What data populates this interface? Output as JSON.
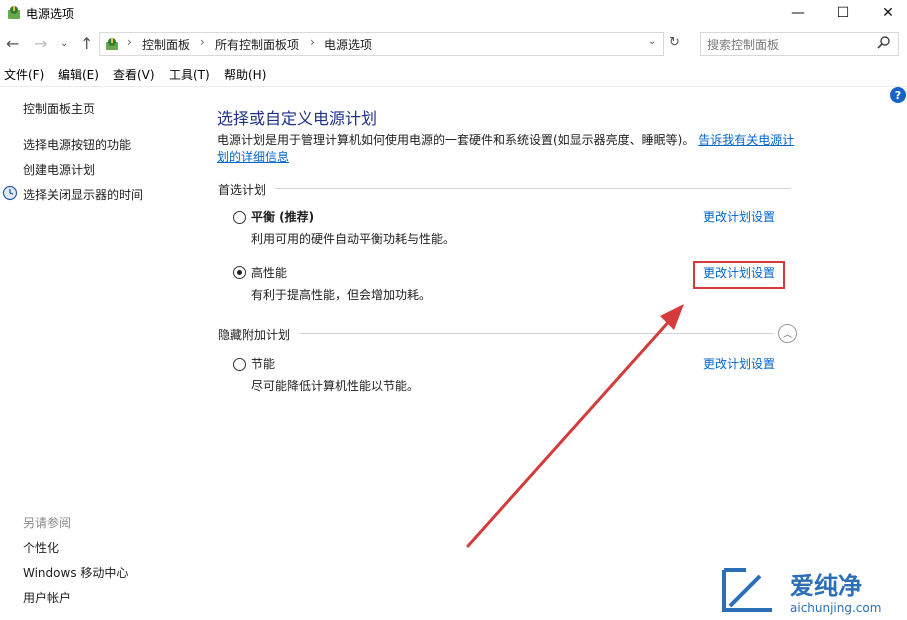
{
  "window": {
    "title": "电源选项",
    "controls": {
      "minimize": "—",
      "maximize": "☐",
      "close": "✕"
    }
  },
  "addressbar": {
    "breadcrumbs": [
      "控制面板",
      "所有控制面板项",
      "电源选项"
    ],
    "search_placeholder": "搜索控制面板"
  },
  "menu": [
    "文件(F)",
    "编辑(E)",
    "查看(V)",
    "工具(T)",
    "帮助(H)"
  ],
  "left_pane": {
    "home": "控制面板主页",
    "links": [
      "选择电源按钮的功能",
      "创建电源计划",
      "选择关闭显示器的时间"
    ],
    "see_also_title": "另请参阅",
    "see_also": [
      "个性化",
      "Windows 移动中心",
      "用户帐户"
    ]
  },
  "main": {
    "heading": "选择或自定义电源计划",
    "description": "电源计划是用于管理计算机如何使用电源的一套硬件和系统设置(如显示器亮度、睡眠等)。",
    "description_link": "告诉我有关电源计划的详细信息",
    "preferred_label": "首选计划",
    "hidden_label": "隐藏附加计划",
    "change_label": "更改计划设置",
    "plans": [
      {
        "name": "平衡 (推荐)",
        "desc": "利用可用的硬件自动平衡功耗与性能。",
        "selected": false
      },
      {
        "name": "高性能",
        "desc": "有利于提高性能，但会增加功耗。",
        "selected": true
      }
    ],
    "hidden_plans": [
      {
        "name": "节能",
        "desc": "尽可能降低计算机性能以节能。",
        "selected": false
      }
    ]
  },
  "watermark": {
    "text": "爱纯净",
    "url": "aichunjing.com"
  },
  "colors": {
    "accent": "#0066cc",
    "heading": "#1e3287",
    "annotation": "#d63b3b"
  }
}
